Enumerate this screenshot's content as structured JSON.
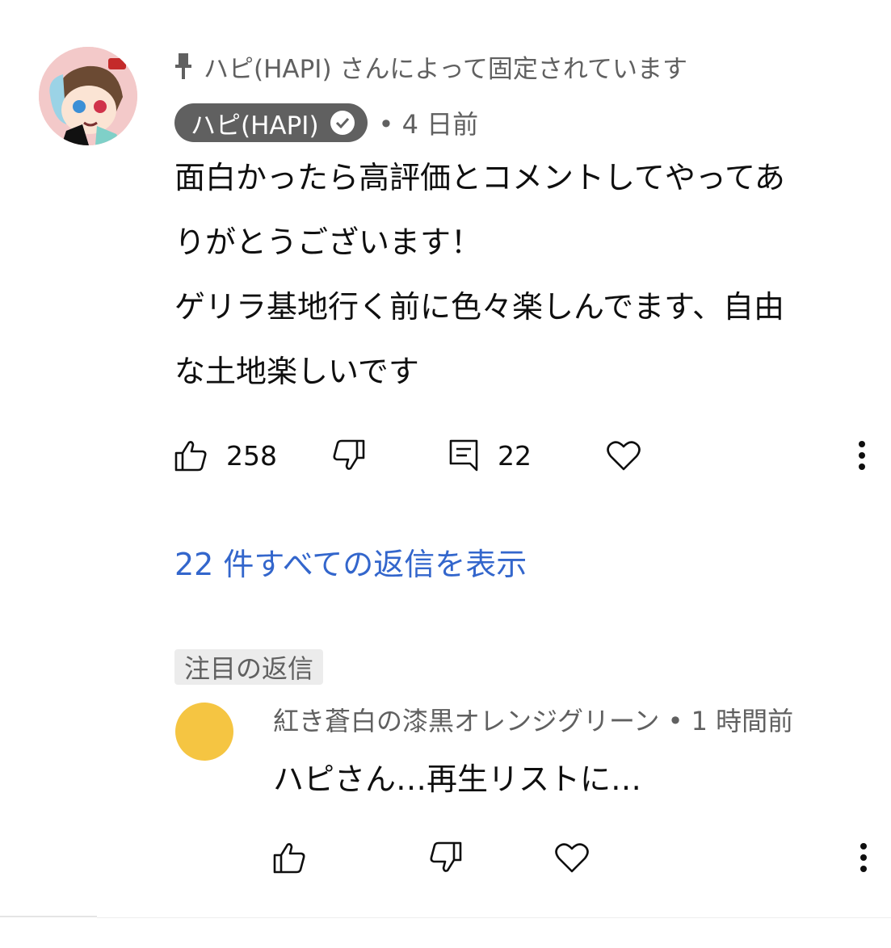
{
  "pinned": {
    "pinned_label": "ハピ(HAPI) さんによって固定されています",
    "author": "ハピ(HAPI)",
    "time": "• 4 日前",
    "text_lines": [
      "面白かったら高評価とコメントしてやってあ",
      "りがとうございます！",
      "ゲリラ基地行く前に色々楽しんでます、自由",
      "な土地楽しいです"
    ],
    "like_count": "258",
    "reply_count": "22",
    "view_replies": "22 件すべての返信を表示"
  },
  "featured": {
    "label": "注目の返信",
    "reply": {
      "author": "紅き蒼白の漆黒オレンジグリーン",
      "time": "• 1 時間前",
      "text": "ハピさん…再生リストに…"
    }
  },
  "colors": {
    "link": "#3366cc",
    "chip_bg": "#606060",
    "secondary_text": "#606060",
    "reply_avatar": "#f5c542"
  },
  "icons": [
    "pin-icon",
    "verified-icon",
    "thumb-up-icon",
    "thumb-down-icon",
    "comment-icon",
    "heart-icon",
    "more-vert-icon"
  ]
}
